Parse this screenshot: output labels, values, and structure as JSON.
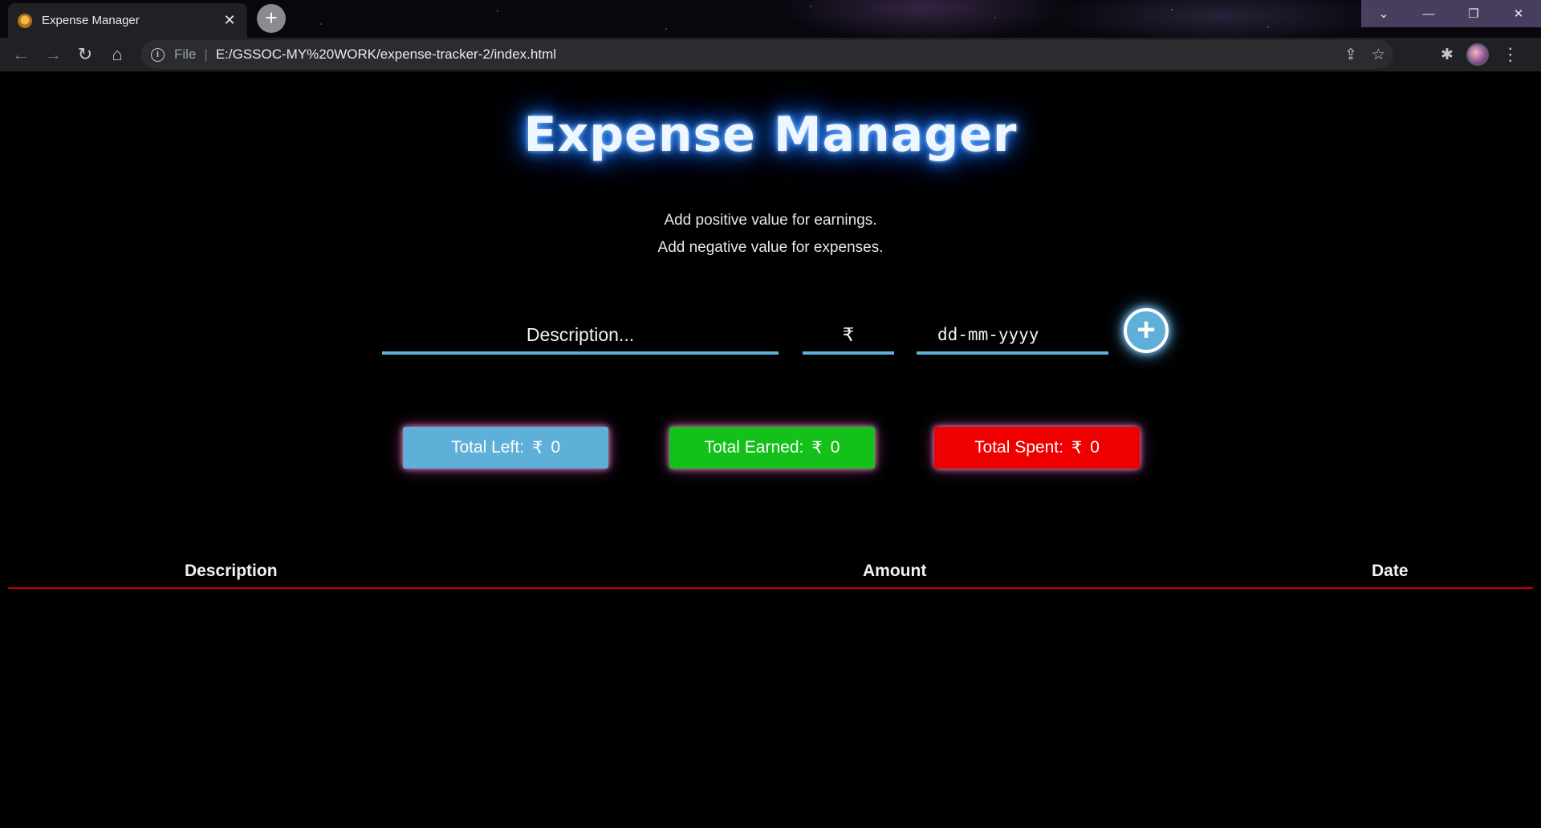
{
  "browser": {
    "tab_title": "Expense Manager",
    "tab_close": "✕",
    "new_tab": "+",
    "window_controls": {
      "chevron": "⌄",
      "minimize": "—",
      "restore": "❐",
      "close": "✕"
    },
    "nav": {
      "back": "←",
      "forward": "→",
      "reload": "↻",
      "home": "⌂"
    },
    "address": {
      "scheme": "File",
      "separator": "|",
      "url": "E:/GSSOC-MY%20WORK/expense-tracker-2/index.html"
    },
    "icons": {
      "share": "⇪",
      "star": "☆",
      "extensions": "✱",
      "menu": "⋮"
    }
  },
  "app": {
    "title": "Expense Manager",
    "hint_positive": "Add positive value for earnings.",
    "hint_negative": "Add negative value for expenses.",
    "form": {
      "description_placeholder": "Description...",
      "description_value": "",
      "amount_placeholder": "₹",
      "amount_value": "",
      "date_placeholder": "dd-mm-yyyy",
      "date_value": "",
      "add_button_icon": "+"
    },
    "totals": {
      "left": {
        "label": "Total Left:",
        "currency": "₹",
        "value": "0"
      },
      "earned": {
        "label": "Total Earned:",
        "currency": "₹",
        "value": "0"
      },
      "spent": {
        "label": "Total Spent:",
        "currency": "₹",
        "value": "0"
      }
    },
    "table": {
      "headers": [
        "Description",
        "Amount",
        "Date"
      ],
      "rows": []
    },
    "colors": {
      "accent": "#5fb0d8",
      "earned": "#14c11a",
      "spent": "#ee0000",
      "table_rule": "#c40000",
      "title_glow": "#2f8cff"
    }
  }
}
